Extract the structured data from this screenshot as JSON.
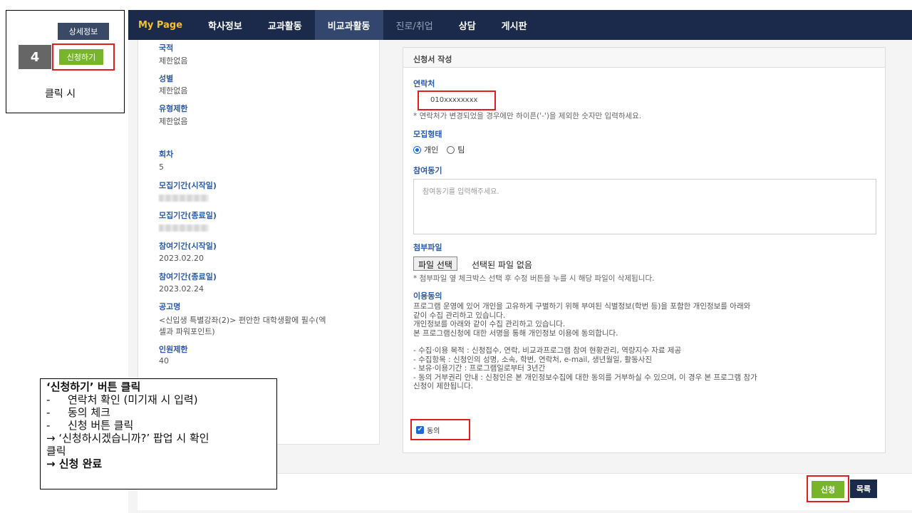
{
  "nav": {
    "items": [
      "My Page",
      "학사정보",
      "교과활동",
      "비교과활동",
      "진로/취업",
      "상담",
      "게시판"
    ]
  },
  "left": {
    "nationality_label": "국적",
    "nationality_value": "제한없음",
    "gender_label": "성별",
    "gender_value": "제한없음",
    "type_label": "유형제한",
    "type_value": "제한없음",
    "round_label": "회차",
    "round_value": "5",
    "recruit_start_label": "모집기간(시작일)",
    "recruit_end_label": "모집기간(종료일)",
    "participate_start_label": "참여기간(시작일)",
    "participate_start_value": "2023.02.20",
    "participate_end_label": "참여기간(종료일)",
    "participate_end_value": "2023.02.24",
    "notice_label": "공고명",
    "notice_value_1": "<신입생 특별강좌(2)> 편안한 대학생활에 필수(엑",
    "notice_value_2": "셀과 파워포인트)",
    "limit_label": "인원제한",
    "limit_value": "40"
  },
  "form": {
    "header": "신청서 작성",
    "contact_label": "연락처",
    "contact_value": "010xxxxxxxx",
    "contact_note": "* 연락처가 변경되었을 경우에만 하이픈('-')을 제외한 숫자만 입력하세요.",
    "recruit_type_label": "모집형태",
    "radio_individual": "개인",
    "radio_team": "팀",
    "motive_label": "참여동기",
    "motive_placeholder": "참여동기를 입력해주세요.",
    "attach_label": "첨부파일",
    "file_button": "파일 선택",
    "file_none": "선택된 파일 없음",
    "attach_note": "* 첨부파일 옆 체크박스 선택 후 수정 버튼을 누를 시 해당 파일이 삭제됩니다.",
    "consent_label": "이용동의",
    "consent_lines": [
      "프로그램 운영에 있어 개인을 고유하게 구별하기 위해 부여된 식별정보(학번 등)을 포함한 개인정보를 아래와",
      "같이 수집 관리하고 있습니다.",
      "개인정보를 아래와 같이 수집 관리하고 있습니다.",
      "본 프로그램신청에 대한 서명을 통해 개인정보 이용에 동의합니다.",
      "",
      "- 수집·이용 목적 : 신청접수, 연락, 비교과프로그램 참여 현황관리, 역량지수 자료 제공",
      "- 수집항목 : 신청인의 성명, 소속, 학번, 연락처, e-mail, 생년월일, 활동사진",
      "- 보유·이용기간 : 프로그램일로부터 3년간",
      "- 동의 거부권리 안내 : 신청인은 본 개인정보수집에 대한 동의를 거부하실 수 있으며, 이 경우 본 프로그램 참가",
      "신청이 제한됩니다."
    ],
    "agree_label": "동의"
  },
  "actions": {
    "apply": "신청",
    "list": "목록"
  },
  "callout": {
    "detail": "상세정보",
    "step": "4",
    "apply": "신청하기",
    "caption": "클릭 시"
  },
  "instructions": {
    "title": "‘신청하기’ 버튼 클릭",
    "steps": [
      "연락처 확인 (미기재 시 입력)",
      "동의 체크",
      "신청 버튼 클릭"
    ],
    "popup_line_1": "→ ‘신청하시겠습니까?’ 팝업 시 확인",
    "popup_line_2": "클릭",
    "done": "→ 신청 완료"
  }
}
